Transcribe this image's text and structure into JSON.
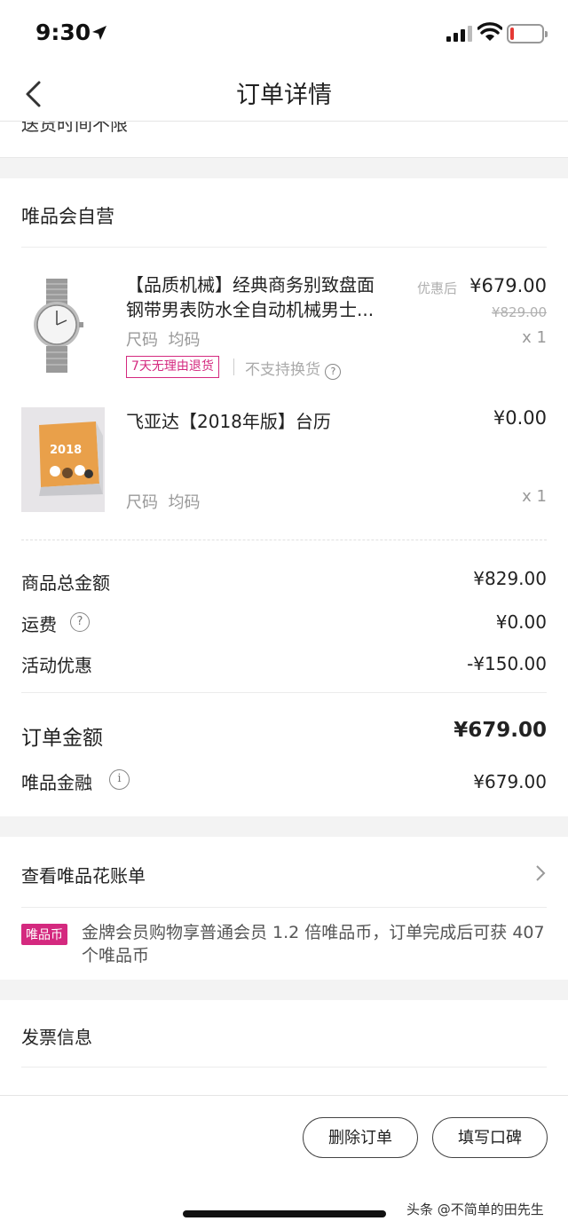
{
  "status": {
    "time": "9:30"
  },
  "nav": {
    "title": "订单详情"
  },
  "cut_text": "送货时间不限",
  "store": {
    "name": "唯品会自营"
  },
  "products": [
    {
      "title": "【品质机械】经典商务别致盘面钢带男表防水全自动机械男士...",
      "title_line1": "【品质机械】经典商务别致盘面",
      "title_line2": "钢带男表防水全自动机械男士...",
      "discount_label": "优惠后",
      "price": "¥679.00",
      "original_price": "¥829.00",
      "spec_label": "尺码",
      "spec_value": "均码",
      "qty": "x 1",
      "tag": "7天无理由退货",
      "no_exchange": "不支持换货",
      "image": "watch-image"
    },
    {
      "title": "飞亚达【2018年版】台历",
      "price": "¥0.00",
      "spec_label": "尺码",
      "spec_value": "均码",
      "qty": "x 1",
      "image": "calendar-image",
      "calendar_year": "2018"
    }
  ],
  "summary": {
    "goods_total_label": "商品总金额",
    "goods_total": "¥829.00",
    "shipping_label": "运费",
    "shipping": "¥0.00",
    "promo_label": "活动优惠",
    "promo": "-¥150.00",
    "order_total_label": "订单金额",
    "order_total": "¥679.00",
    "finance_label": "唯品金融",
    "finance": "¥679.00"
  },
  "bill": {
    "label": "查看唯品花账单"
  },
  "coin": {
    "badge": "唯品币",
    "text": "金牌会员购物享普通会员 1.2 倍唯品币，订单完成后可获 407 个唯品币"
  },
  "invoice": {
    "label": "发票信息"
  },
  "actions": {
    "delete": "删除订单",
    "review": "填写口碑"
  },
  "watermark": "头条 @不简单的田先生",
  "colors": {
    "accent": "#d4297f",
    "background": "#f3f3f3"
  }
}
